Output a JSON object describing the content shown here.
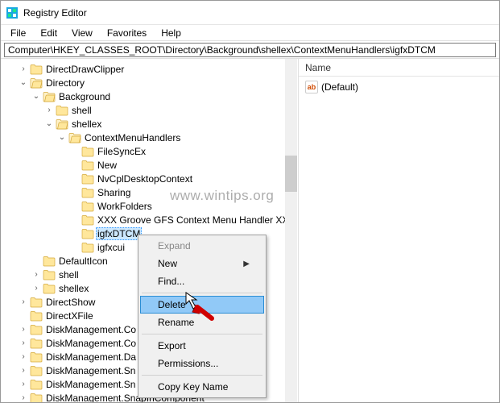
{
  "window": {
    "title": "Registry Editor"
  },
  "menu": {
    "file": "File",
    "edit": "Edit",
    "view": "View",
    "favorites": "Favorites",
    "help": "Help"
  },
  "address": {
    "value": "Computer\\HKEY_CLASSES_ROOT\\Directory\\Background\\shellex\\ContextMenuHandlers\\igfxDTCM"
  },
  "tree": {
    "n_directdrawclipper": "DirectDrawClipper",
    "n_directory": "Directory",
    "n_background": "Background",
    "n_shell": "shell",
    "n_shellex": "shellex",
    "n_contextmenuhandlers": "ContextMenuHandlers",
    "n_filesyncex": "FileSyncEx",
    "n_new": "New",
    "n_nvcpl": "NvCplDesktopContext",
    "n_sharing": "Sharing",
    "n_workfolders": "WorkFolders",
    "n_xxx": "XXX Groove GFS Context Menu Handler XX",
    "n_igfxdtcm": "igfxDTCM",
    "n_igfxcui": "igfxcui",
    "n_defaulticon": "DefaultIcon",
    "n_shell2": "shell",
    "n_shellex2": "shellex",
    "n_directshow": "DirectShow",
    "n_directxfile": "DirectXFile",
    "n_dm1": "DiskManagement.Co",
    "n_dm2": "DiskManagement.Co",
    "n_dm3": "DiskManagement.Da",
    "n_dm4": "DiskManagement.Sn",
    "n_dm5": "DiskManagement.Sn",
    "n_dm6": "DiskManagement.SnapInComponent"
  },
  "list": {
    "header_name": "Name",
    "value_default": "(Default)"
  },
  "ctx": {
    "expand": "Expand",
    "new": "New",
    "find": "Find...",
    "delete": "Delete",
    "rename": "Rename",
    "export": "Export",
    "permissions": "Permissions...",
    "copykeyname": "Copy Key Name"
  },
  "watermark": "www.wintips.org"
}
